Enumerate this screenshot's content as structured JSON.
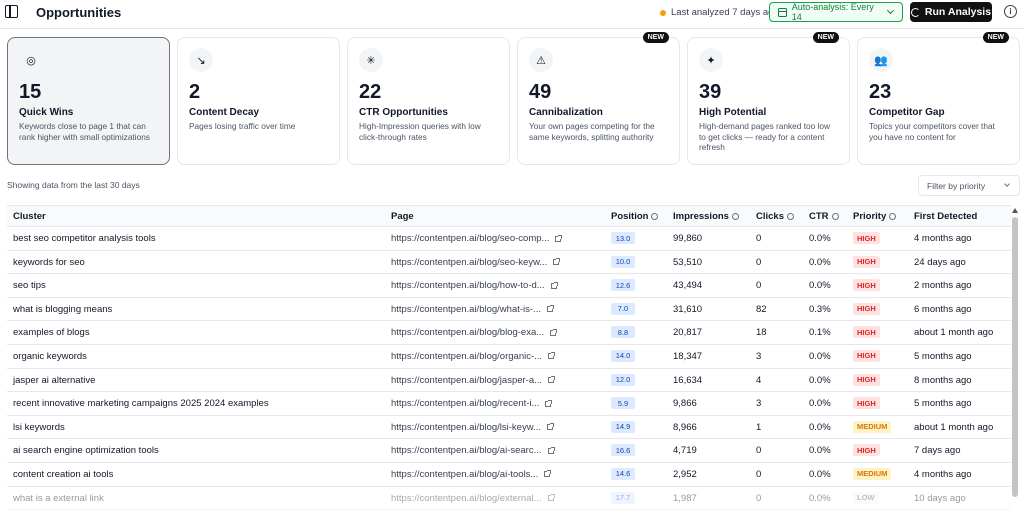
{
  "header": {
    "title": "Opportunities",
    "status_text": "Last analyzed 7 days ago",
    "auto_analysis_label": "Auto-analysis: Every 14",
    "run_label": "Run Analysis"
  },
  "cards": [
    {
      "number": "15",
      "title": "Quick Wins",
      "desc": "Keywords close to page 1 that can rank higher with small optimizations",
      "icon": "target-icon",
      "badge": "",
      "active": true
    },
    {
      "number": "2",
      "title": "Content Decay",
      "desc": "Pages losing traffic over time",
      "icon": "trending-down-icon",
      "badge": "",
      "active": false
    },
    {
      "number": "22",
      "title": "CTR Opportunities",
      "desc": "High-Impression queries with low click-through rates",
      "icon": "click-icon",
      "badge": "",
      "active": false
    },
    {
      "number": "49",
      "title": "Cannibalization",
      "desc": "Your own pages competing for the same keywords, splitting authority",
      "icon": "warning-icon",
      "badge": "NEW",
      "active": false
    },
    {
      "number": "39",
      "title": "High Potential",
      "desc": "High-demand pages ranked too low to get clicks — ready for a content refresh",
      "icon": "sparkle-icon",
      "badge": "NEW",
      "active": false
    },
    {
      "number": "23",
      "title": "Competitor Gap",
      "desc": "Topics your competitors cover that you have no content for",
      "icon": "users-icon",
      "badge": "NEW",
      "active": false
    }
  ],
  "data_note": "Showing data from the last 30 days",
  "filter": {
    "placeholder": "Filter by priority"
  },
  "table": {
    "columns": [
      "Cluster",
      "Page",
      "Position",
      "Impressions",
      "Clicks",
      "CTR",
      "Priority",
      "First Detected"
    ],
    "rows": [
      {
        "cluster": "best seo competitor analysis tools",
        "page": "https://contentpen.ai/blog/seo-comp...",
        "position": "13.0",
        "impressions": "99,860",
        "clicks": "0",
        "ctr": "0.0%",
        "priority": "HIGH",
        "detected": "4 months ago"
      },
      {
        "cluster": "keywords for seo",
        "page": "https://contentpen.ai/blog/seo-keyw...",
        "position": "10.0",
        "impressions": "53,510",
        "clicks": "0",
        "ctr": "0.0%",
        "priority": "HIGH",
        "detected": "24 days ago"
      },
      {
        "cluster": "seo tips",
        "page": "https://contentpen.ai/blog/how-to-d...",
        "position": "12.6",
        "impressions": "43,494",
        "clicks": "0",
        "ctr": "0.0%",
        "priority": "HIGH",
        "detected": "2 months ago"
      },
      {
        "cluster": "what is blogging means",
        "page": "https://contentpen.ai/blog/what-is-...",
        "position": "7.0",
        "impressions": "31,610",
        "clicks": "82",
        "ctr": "0.3%",
        "priority": "HIGH",
        "detected": "6 months ago"
      },
      {
        "cluster": "examples of blogs",
        "page": "https://contentpen.ai/blog/blog-exa...",
        "position": "8.8",
        "impressions": "20,817",
        "clicks": "18",
        "ctr": "0.1%",
        "priority": "HIGH",
        "detected": "about 1 month ago"
      },
      {
        "cluster": "organic keywords",
        "page": "https://contentpen.ai/blog/organic-...",
        "position": "14.0",
        "impressions": "18,347",
        "clicks": "3",
        "ctr": "0.0%",
        "priority": "HIGH",
        "detected": "5 months ago"
      },
      {
        "cluster": "jasper ai alternative",
        "page": "https://contentpen.ai/blog/jasper-a...",
        "position": "12.0",
        "impressions": "16,634",
        "clicks": "4",
        "ctr": "0.0%",
        "priority": "HIGH",
        "detected": "8 months ago"
      },
      {
        "cluster": "recent innovative marketing campaigns 2025 2024 examples",
        "page": "https://contentpen.ai/blog/recent-i...",
        "position": "5.9",
        "impressions": "9,866",
        "clicks": "3",
        "ctr": "0.0%",
        "priority": "HIGH",
        "detected": "5 months ago"
      },
      {
        "cluster": "lsi keywords",
        "page": "https://contentpen.ai/blog/lsi-keyw...",
        "position": "14.9",
        "impressions": "8,966",
        "clicks": "1",
        "ctr": "0.0%",
        "priority": "MEDIUM",
        "detected": "about 1 month ago"
      },
      {
        "cluster": "ai search engine optimization tools",
        "page": "https://contentpen.ai/blog/ai-searc...",
        "position": "16.6",
        "impressions": "4,719",
        "clicks": "0",
        "ctr": "0.0%",
        "priority": "HIGH",
        "detected": "7 days ago"
      },
      {
        "cluster": "content creation ai tools",
        "page": "https://contentpen.ai/blog/ai-tools...",
        "position": "14.6",
        "impressions": "2,952",
        "clicks": "0",
        "ctr": "0.0%",
        "priority": "MEDIUM",
        "detected": "4 months ago"
      },
      {
        "cluster": "what is a external link",
        "page": "https://contentpen.ai/blog/external...",
        "position": "17.7",
        "impressions": "1,987",
        "clicks": "0",
        "ctr": "0.0%",
        "priority": "LOW",
        "detected": "10 days ago"
      }
    ]
  },
  "colors": {
    "accent": "#16a34a",
    "high": "#dc2626",
    "medium": "#d97706",
    "low": "#6b7280",
    "position_badge": "#dbeafe"
  }
}
